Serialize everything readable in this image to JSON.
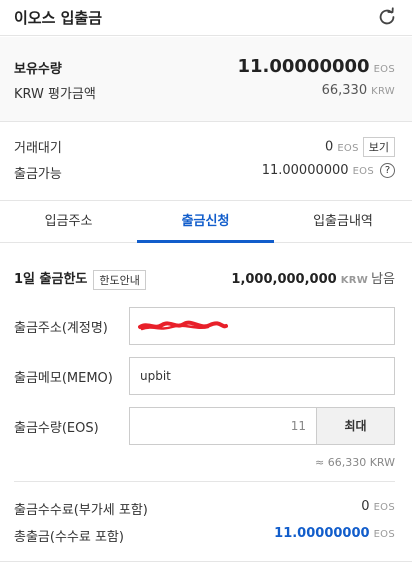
{
  "header": {
    "title": "이오스 입출금",
    "refresh_icon": "refresh-icon"
  },
  "holdings": {
    "label": "보유수량",
    "amount": "11.00000000",
    "unit": "EOS",
    "krw_label": "KRW 평가금액",
    "krw_value": "66,330",
    "krw_unit": "KRW"
  },
  "status": {
    "pending_label": "거래대기",
    "pending_value": "0",
    "pending_unit": "EOS",
    "view_button": "보기",
    "withdrawable_label": "출금가능",
    "withdrawable_value": "11.00000000",
    "withdrawable_unit": "EOS",
    "help_glyph": "?"
  },
  "tabs": [
    "입금주소",
    "출금신청",
    "입출금내역"
  ],
  "limit": {
    "label": "1일 출금한도",
    "info_button": "한도안내",
    "value": "1,000,000,000",
    "unit": "KRW",
    "suffix": "남음"
  },
  "form": {
    "address_label": "출금주소(계정명)",
    "memo_label": "출금메모(MEMO)",
    "memo_value": "upbit",
    "quantity_label": "출금수량(EOS)",
    "quantity_value": "11",
    "max_button": "최대",
    "approx_value": "≈ 66,330 KRW"
  },
  "fees": {
    "fee_label": "출금수수료(부가세 포함)",
    "fee_value": "0",
    "fee_unit": "EOS",
    "total_label": "총출금(수수료 포함)",
    "total_value": "11.00000000",
    "total_unit": "EOS"
  },
  "colors": {
    "accent": "#115dcb",
    "redaction": "#e8202a"
  }
}
